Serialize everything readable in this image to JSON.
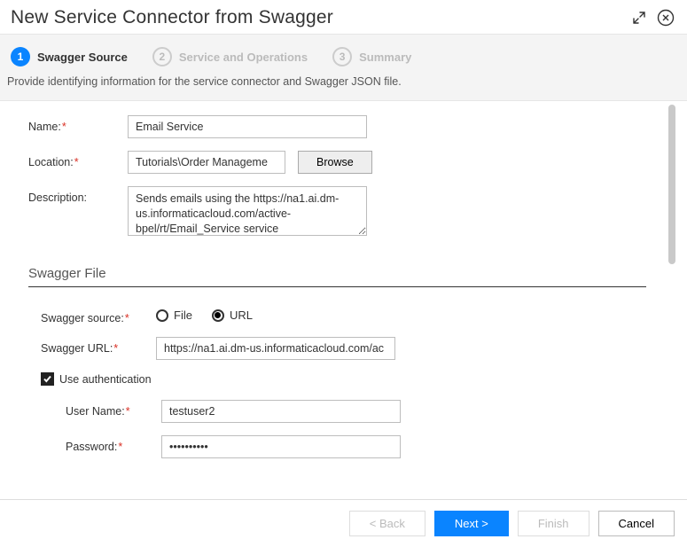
{
  "title": "New Service Connector from Swagger",
  "steps": [
    {
      "num": "1",
      "label": "Swagger Source",
      "active": true
    },
    {
      "num": "2",
      "label": "Service and Operations",
      "active": false
    },
    {
      "num": "3",
      "label": "Summary",
      "active": false
    }
  ],
  "instruction": "Provide identifying information for the service connector and Swagger JSON file.",
  "form": {
    "name_label": "Name:",
    "name_value": "Email Service",
    "location_label": "Location:",
    "location_value": "Tutorials\\Order Manageme",
    "browse_label": "Browse",
    "description_label": "Description:",
    "description_value": "Sends emails using the https://na1.ai.dm-us.informaticacloud.com/active-bpel/rt/Email_Service service"
  },
  "swagger": {
    "section_title": "Swagger File",
    "source_label": "Swagger source:",
    "option_file": "File",
    "option_url": "URL",
    "url_label": "Swagger URL:",
    "url_value": "https://na1.ai.dm-us.informaticacloud.com/ac",
    "auth_label": "Use authentication",
    "username_label": "User Name:",
    "username_value": "testuser2",
    "password_label": "Password:",
    "password_value": "••••••••••"
  },
  "buttons": {
    "back": "< Back",
    "next": "Next >",
    "finish": "Finish",
    "cancel": "Cancel"
  }
}
